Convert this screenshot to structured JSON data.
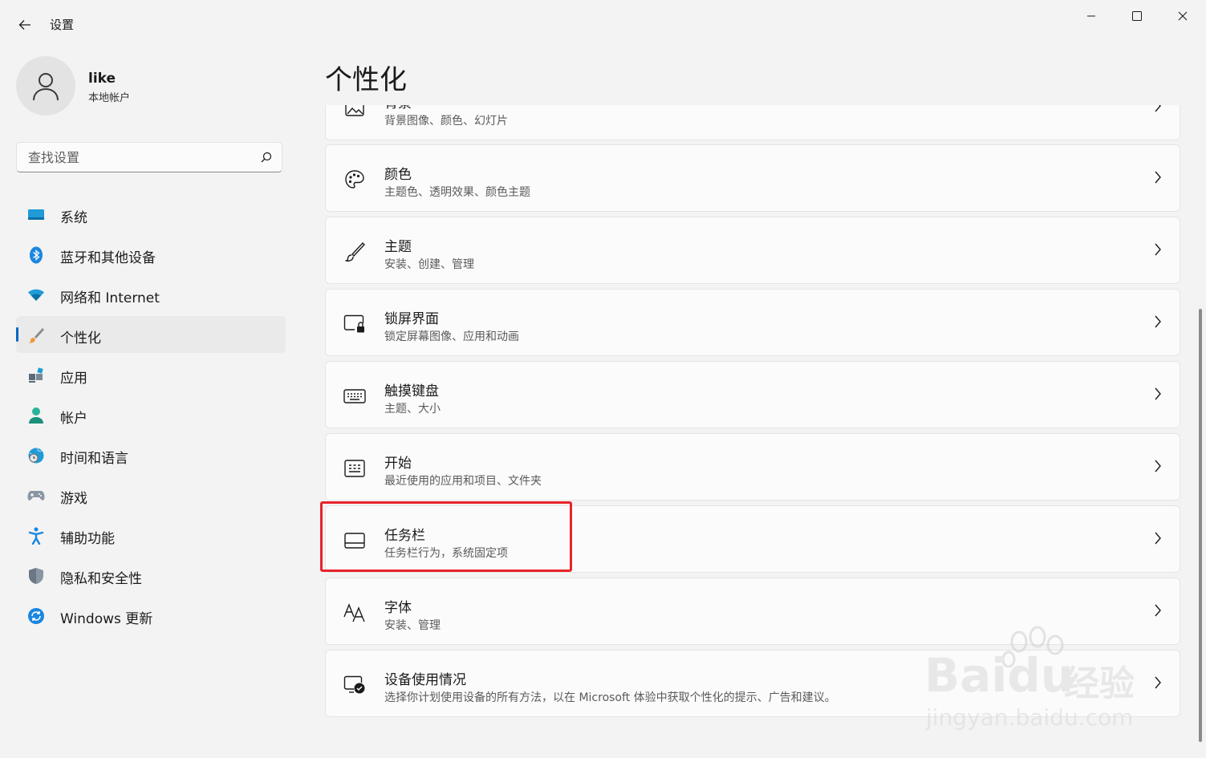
{
  "window": {
    "title": "设置"
  },
  "profile": {
    "name": "like",
    "type": "本地帐户"
  },
  "search": {
    "placeholder": "查找设置"
  },
  "sidebar": {
    "items": [
      {
        "label": "系统",
        "icon": "system-icon"
      },
      {
        "label": "蓝牙和其他设备",
        "icon": "bluetooth-icon"
      },
      {
        "label": "网络和 Internet",
        "icon": "wifi-icon"
      },
      {
        "label": "个性化",
        "icon": "brush-icon",
        "active": true
      },
      {
        "label": "应用",
        "icon": "apps-icon"
      },
      {
        "label": "帐户",
        "icon": "account-icon"
      },
      {
        "label": "时间和语言",
        "icon": "globe-clock-icon"
      },
      {
        "label": "游戏",
        "icon": "gamepad-icon"
      },
      {
        "label": "辅助功能",
        "icon": "accessibility-icon"
      },
      {
        "label": "隐私和安全性",
        "icon": "shield-icon"
      },
      {
        "label": "Windows 更新",
        "icon": "update-icon"
      }
    ]
  },
  "main": {
    "title": "个性化",
    "cards": [
      {
        "title": "背景",
        "subtitle": "背景图像、颜色、幻灯片",
        "icon": "image-icon"
      },
      {
        "title": "颜色",
        "subtitle": "主题色、透明效果、颜色主题",
        "icon": "palette-icon"
      },
      {
        "title": "主题",
        "subtitle": "安装、创建、管理",
        "icon": "brush-icon"
      },
      {
        "title": "锁屏界面",
        "subtitle": "锁定屏幕图像、应用和动画",
        "icon": "lock-screen-icon"
      },
      {
        "title": "触摸键盘",
        "subtitle": "主题、大小",
        "icon": "keyboard-icon"
      },
      {
        "title": "开始",
        "subtitle": "最近使用的应用和项目、文件夹",
        "icon": "start-icon"
      },
      {
        "title": "任务栏",
        "subtitle": "任务栏行为，系统固定项",
        "icon": "taskbar-icon"
      },
      {
        "title": "字体",
        "subtitle": "安装、管理",
        "icon": "font-icon"
      },
      {
        "title": "设备使用情况",
        "subtitle": "选择你计划使用设备的所有方法，以在 Microsoft 体验中获取个性化的提示、广告和建议。",
        "icon": "device-usage-icon"
      }
    ]
  },
  "watermark": {
    "brand": "Baidu",
    "brand_cn": "经验",
    "url": "jingyan.baidu.com"
  },
  "colors": {
    "accent": "#0067c0",
    "highlight": "#e8232a",
    "background": "#f3f3f3",
    "card": "#fbfbfb"
  }
}
